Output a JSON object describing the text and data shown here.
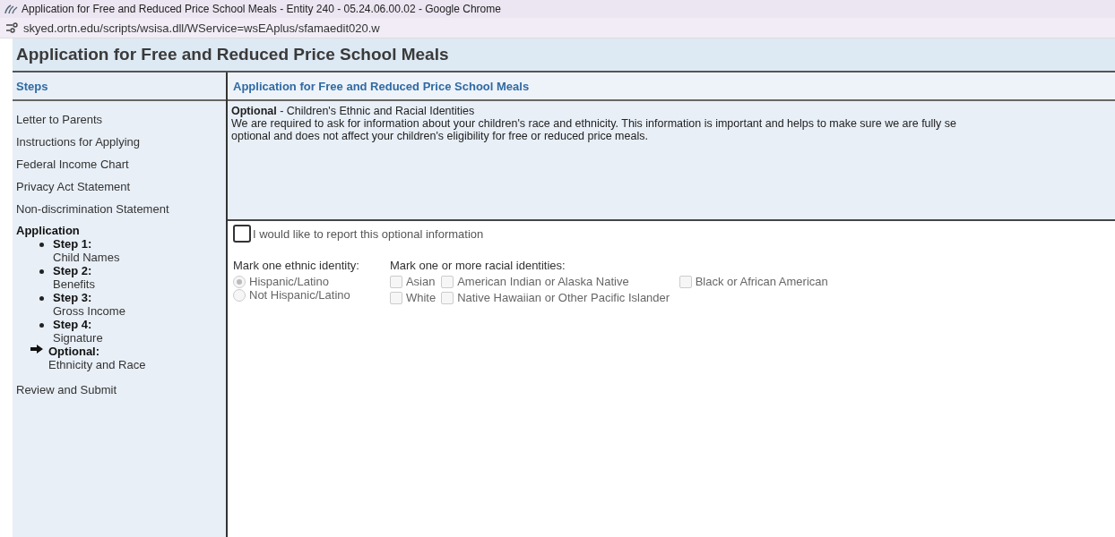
{
  "browser": {
    "title": "Application for Free and Reduced Price School Meals - Entity 240 - 05.24.06.00.02 - Google Chrome",
    "url": "skyed.ortn.edu/scripts/wsisa.dll/WService=wsEAplus/sfamaedit020.w"
  },
  "page_title": "Application for Free and Reduced Price School Meals",
  "sidebar": {
    "heading": "Steps",
    "items": [
      {
        "label": "Letter to Parents"
      },
      {
        "label": "Instructions for Applying"
      },
      {
        "label": "Federal Income Chart"
      },
      {
        "label": "Privacy Act Statement"
      },
      {
        "label": "Non-discrimination Statement"
      }
    ],
    "section": "Application",
    "steps": [
      {
        "label": "Step 1:",
        "detail": "Child Names",
        "selected": false
      },
      {
        "label": "Step 2:",
        "detail": "Benefits",
        "selected": false
      },
      {
        "label": "Step 3:",
        "detail": "Gross Income",
        "selected": false
      },
      {
        "label": "Step 4:",
        "detail": "Signature",
        "selected": false
      },
      {
        "label": "Optional:",
        "detail": "Ethnicity and Race",
        "selected": true
      }
    ],
    "after": [
      {
        "label": "Review and Submit"
      }
    ]
  },
  "main": {
    "heading": "Application for Free and Reduced Price School Meals",
    "intro_title": "**Optional** - Children's Ethnic and Racial Identities",
    "intro_lines": [
      "We are required to ask for information about your children's race and ethnicity. This information is important and helps to make sure we are fully se",
      "optional and does not affect your children's eligibility for free or reduced price meals."
    ],
    "report_option": {
      "label": "I would like to report this optional information",
      "checked": false
    },
    "ethnic": {
      "label": "Mark one ethnic identity:",
      "options": [
        {
          "label": "Hispanic/Latino",
          "selected": true,
          "disabled": true
        },
        {
          "label": "Not Hispanic/Latino",
          "selected": false,
          "disabled": true
        }
      ]
    },
    "racial": {
      "label": "Mark one or more racial identities:",
      "options": [
        {
          "label": "Asian",
          "checked": false,
          "disabled": true
        },
        {
          "label": "American Indian or Alaska Native",
          "checked": false,
          "disabled": true
        },
        {
          "label": "Black or African American",
          "checked": false,
          "disabled": true
        },
        {
          "label": "White",
          "checked": false,
          "disabled": true
        },
        {
          "label": "Native Hawaiian or Other Pacific Islander",
          "checked": false,
          "disabled": true
        }
      ]
    }
  }
}
